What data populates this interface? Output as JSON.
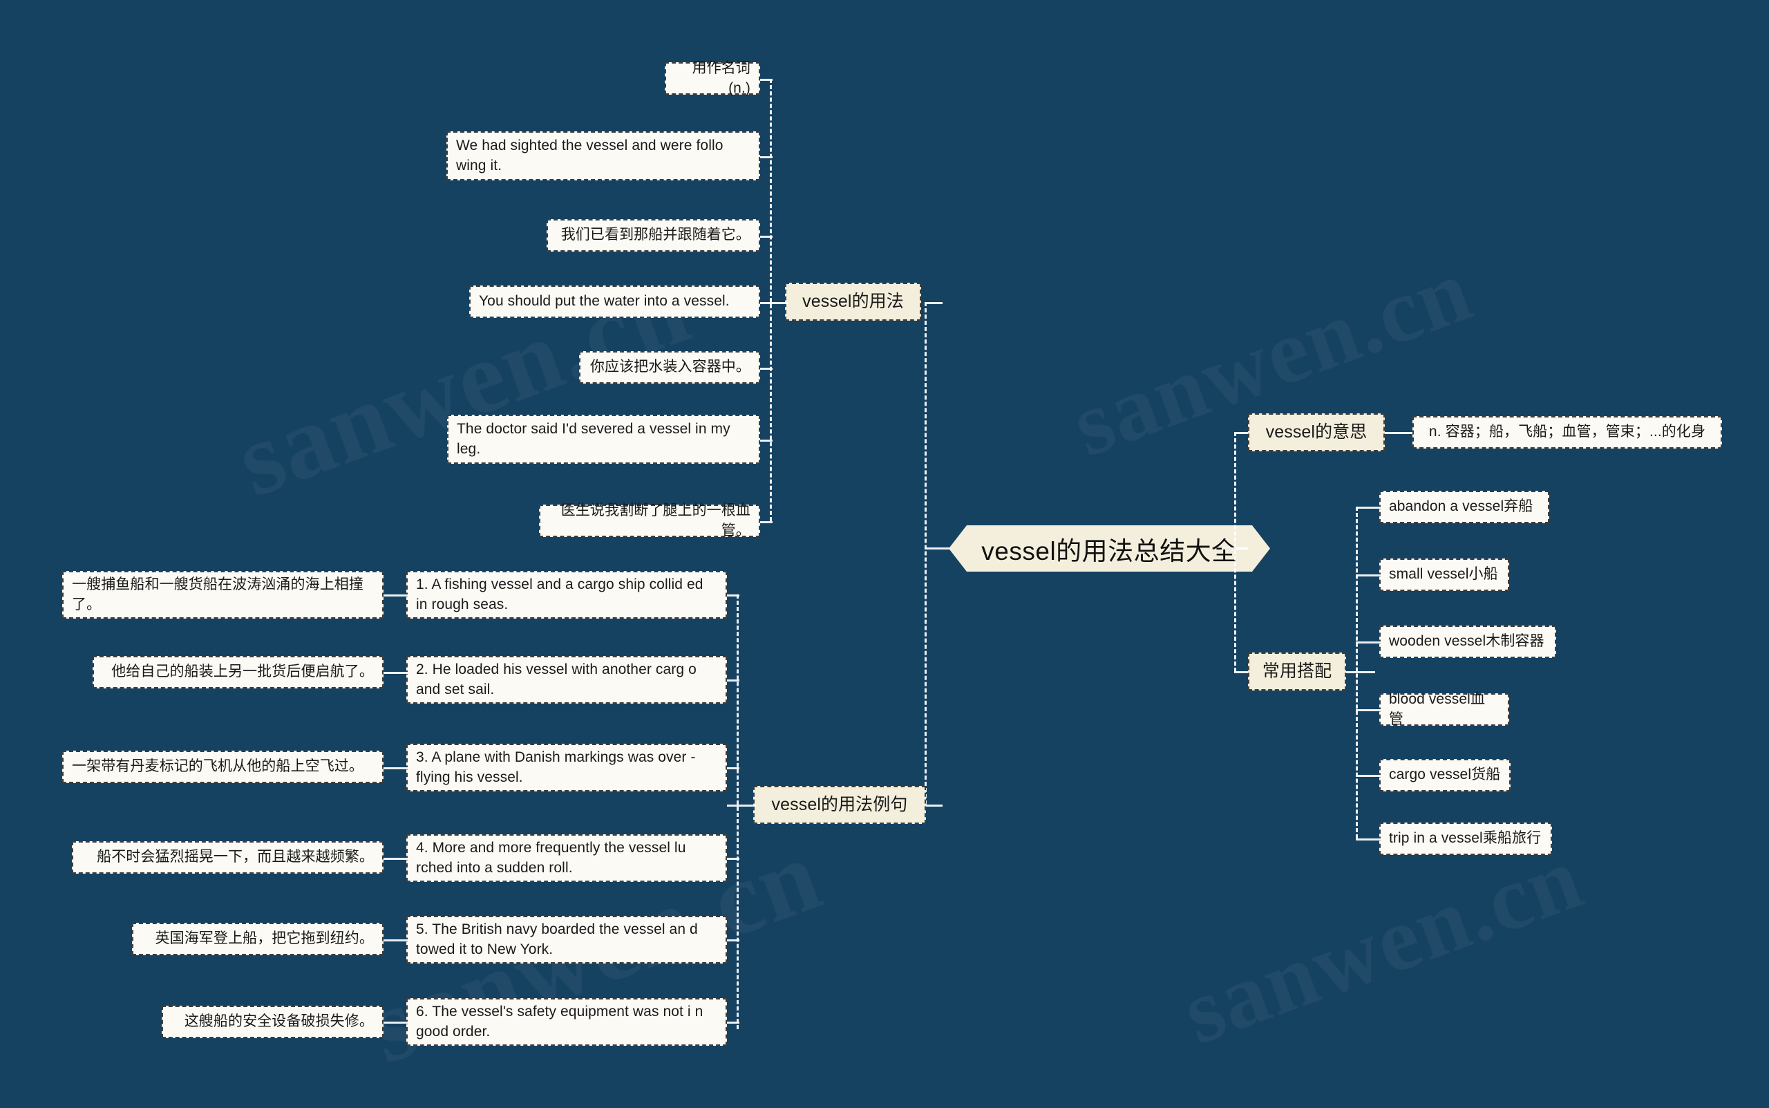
{
  "root": {
    "label": "vessel的用法总结大全"
  },
  "watermarks": [
    {
      "text": "sanwen.cn"
    },
    {
      "text": "sanwen.cn"
    },
    {
      "text": "sanwen.cn"
    },
    {
      "text": "sanwen.cn"
    }
  ],
  "branches": {
    "usage": {
      "label": "vessel的用法",
      "children": [
        {
          "label": "用作名词(n.)"
        },
        {
          "label": "We had sighted the vessel and were follo wing it."
        },
        {
          "label": "我们已看到那船并跟随着它。"
        },
        {
          "label": "You should put the water into a vessel."
        },
        {
          "label": "你应该把水装入容器中。"
        },
        {
          "label": "The doctor said I'd severed a vessel in my leg."
        },
        {
          "label": "医生说我割断了腿上的一根血管。"
        }
      ]
    },
    "examples": {
      "label": "vessel的用法例句",
      "children": [
        {
          "en": "1. A fishing vessel and a cargo ship collid ed in rough seas.",
          "zh": "一艘捕鱼船和一艘货船在波涛汹涌的海上相撞了。"
        },
        {
          "en": "2. He loaded his vessel with another carg o and set sail.",
          "zh": "他给自己的船装上另一批货后便启航了。"
        },
        {
          "en": "3. A plane with Danish markings was over -flying his vessel.",
          "zh": "一架带有丹麦标记的飞机从他的船上空飞过。"
        },
        {
          "en": "4. More and more frequently the vessel lu rched into a sudden roll.",
          "zh": "船不时会猛烈摇晃一下，而且越来越频繁。"
        },
        {
          "en": "5. The British navy boarded the vessel an d towed it to New York.",
          "zh": "英国海军登上船，把它拖到纽约。"
        },
        {
          "en": "6. The vessel's safety equipment was not i n good order.",
          "zh": "这艘船的安全设备破损失修。"
        }
      ]
    },
    "meaning": {
      "label": "vessel的意思",
      "children": [
        {
          "label": "n. 容器；船，飞船；血管，管束；...的化身"
        }
      ]
    },
    "collocation": {
      "label": "常用搭配",
      "children": [
        {
          "label": "abandon a vessel弃船"
        },
        {
          "label": "small vessel小船"
        },
        {
          "label": "wooden vessel木制容器"
        },
        {
          "label": "blood vessel血管"
        },
        {
          "label": "cargo vessel货船"
        },
        {
          "label": "trip in a vessel乘船旅行"
        }
      ]
    }
  },
  "colors": {
    "background": "#164262",
    "node_fill": "#fbfaf4",
    "branch_fill": "#f4efdc",
    "connector": "#ffffff",
    "text": "#1a1a1a"
  }
}
